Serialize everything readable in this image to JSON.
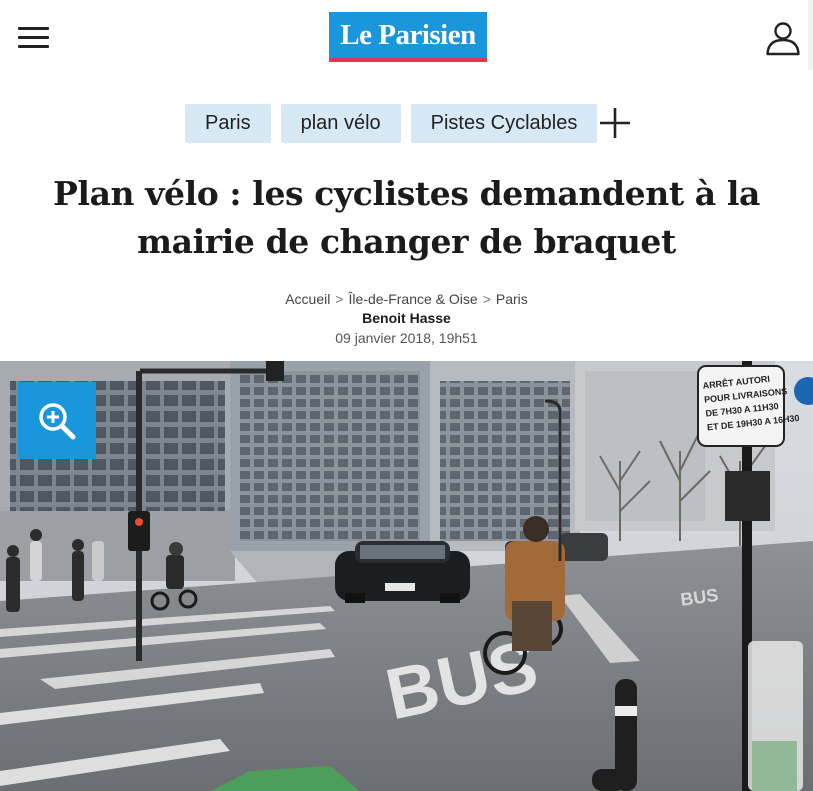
{
  "header": {
    "logo_text": "Le Parisien",
    "menu_icon": "hamburger-menu-icon",
    "user_icon": "user-account-icon",
    "brand_color": "#1a96dc",
    "brand_accent": "#e8334a"
  },
  "tags": [
    {
      "label": "Paris"
    },
    {
      "label": "plan vélo"
    },
    {
      "label": "Pistes Cyclables"
    }
  ],
  "tags_more_icon": "plus-icon",
  "article": {
    "title": "Plan vélo : les cyclistes demandent à la mairie de changer de braquet",
    "breadcrumb": [
      {
        "label": "Accueil"
      },
      {
        "label": "Île-de-France & Oise"
      },
      {
        "label": "Paris"
      }
    ],
    "breadcrumb_separator": ">",
    "author": "Benoit Hasse",
    "date": "09 janvier 2018, 19h51"
  },
  "photo": {
    "zoom_icon": "zoom-in-icon",
    "sign_lines": [
      "ARRÊT AUTORI",
      "POUR LIVRAISONS",
      "DE 7H30 A 11H30",
      "ET DE 19H30 A 16H30"
    ],
    "road_marking": "BUS",
    "road_marking_far": "BUS"
  }
}
